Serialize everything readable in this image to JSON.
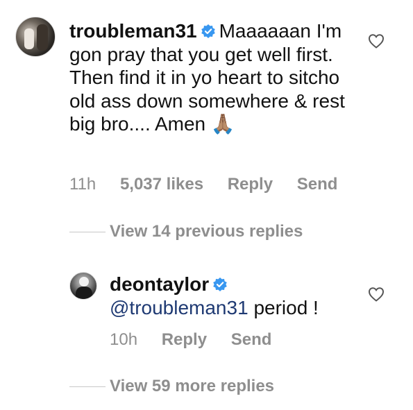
{
  "comment1": {
    "username": "troubleman31",
    "text": "Maaaaaan I'm gon pray that you get well first. Then find it in yo heart to sitcho old ass down somewhere & rest big bro.... Amen",
    "emoji": "🙏🏽",
    "time": "11h",
    "likes": "5,037 likes",
    "reply_label": "Reply",
    "send_label": "Send"
  },
  "view_previous": "View 14 previous replies",
  "comment2": {
    "username": "deontaylor",
    "mention": "@troubleman31",
    "text": "period !",
    "time": "10h",
    "reply_label": "Reply",
    "send_label": "Send"
  },
  "view_more": "View 59 more replies",
  "colors": {
    "verified": "#3897f0",
    "mention": "#1f3a73",
    "meta": "#8e8e8e"
  }
}
